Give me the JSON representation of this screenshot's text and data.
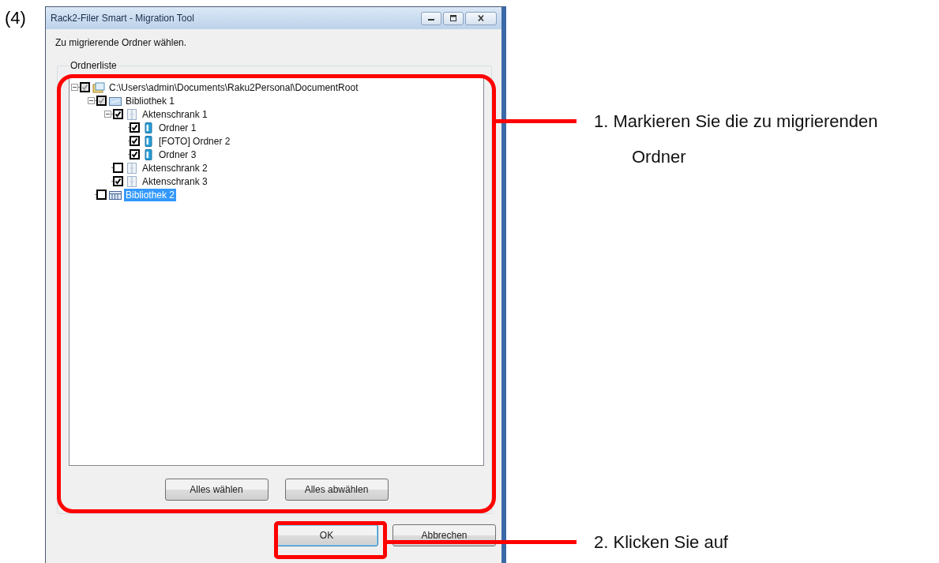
{
  "figure_label": "(4)",
  "window": {
    "title": "Rack2-Filer Smart - Migration Tool"
  },
  "instruction": "Zu migrierende Ordner wählen.",
  "folder_group": {
    "label": "Ordnerliste",
    "tree": [
      {
        "label": "C:\\Users\\admin\\Documents\\Raku2Personal\\DocumentRoot",
        "kind": "drive",
        "checked": true,
        "mixed": true,
        "selected": false,
        "expanded": true,
        "children": [
          {
            "label": "Bibliothek 1",
            "kind": "library",
            "checked": true,
            "mixed": true,
            "selected": false,
            "expanded": true,
            "children": [
              {
                "label": "Aktenschrank 1",
                "kind": "cabinet",
                "checked": true,
                "mixed": false,
                "selected": false,
                "expanded": true,
                "children": [
                  {
                    "label": "Ordner 1",
                    "kind": "binder",
                    "checked": true,
                    "mixed": false,
                    "selected": false
                  },
                  {
                    "label": "[FOTO] Ordner 2",
                    "kind": "binder",
                    "checked": true,
                    "mixed": false,
                    "selected": false
                  },
                  {
                    "label": "Ordner 3",
                    "kind": "binder",
                    "checked": true,
                    "mixed": false,
                    "selected": false
                  }
                ]
              },
              {
                "label": "Aktenschrank 2",
                "kind": "cabinet",
                "checked": false,
                "mixed": false,
                "selected": false
              },
              {
                "label": "Aktenschrank 3",
                "kind": "cabinet",
                "checked": true,
                "mixed": false,
                "selected": false
              }
            ]
          },
          {
            "label": "Bibliothek 2",
            "kind": "grid",
            "checked": false,
            "mixed": false,
            "selected": true
          }
        ]
      }
    ],
    "buttons": [
      "Alles wählen",
      "Alles abwählen"
    ]
  },
  "dialog_buttons": [
    {
      "label": "OK",
      "focused": true
    },
    {
      "label": "Abbrechen",
      "focused": false
    }
  ],
  "callouts": [
    "1. Markieren Sie die zu migrierenden Ordner",
    "2. Klicken Sie auf"
  ]
}
